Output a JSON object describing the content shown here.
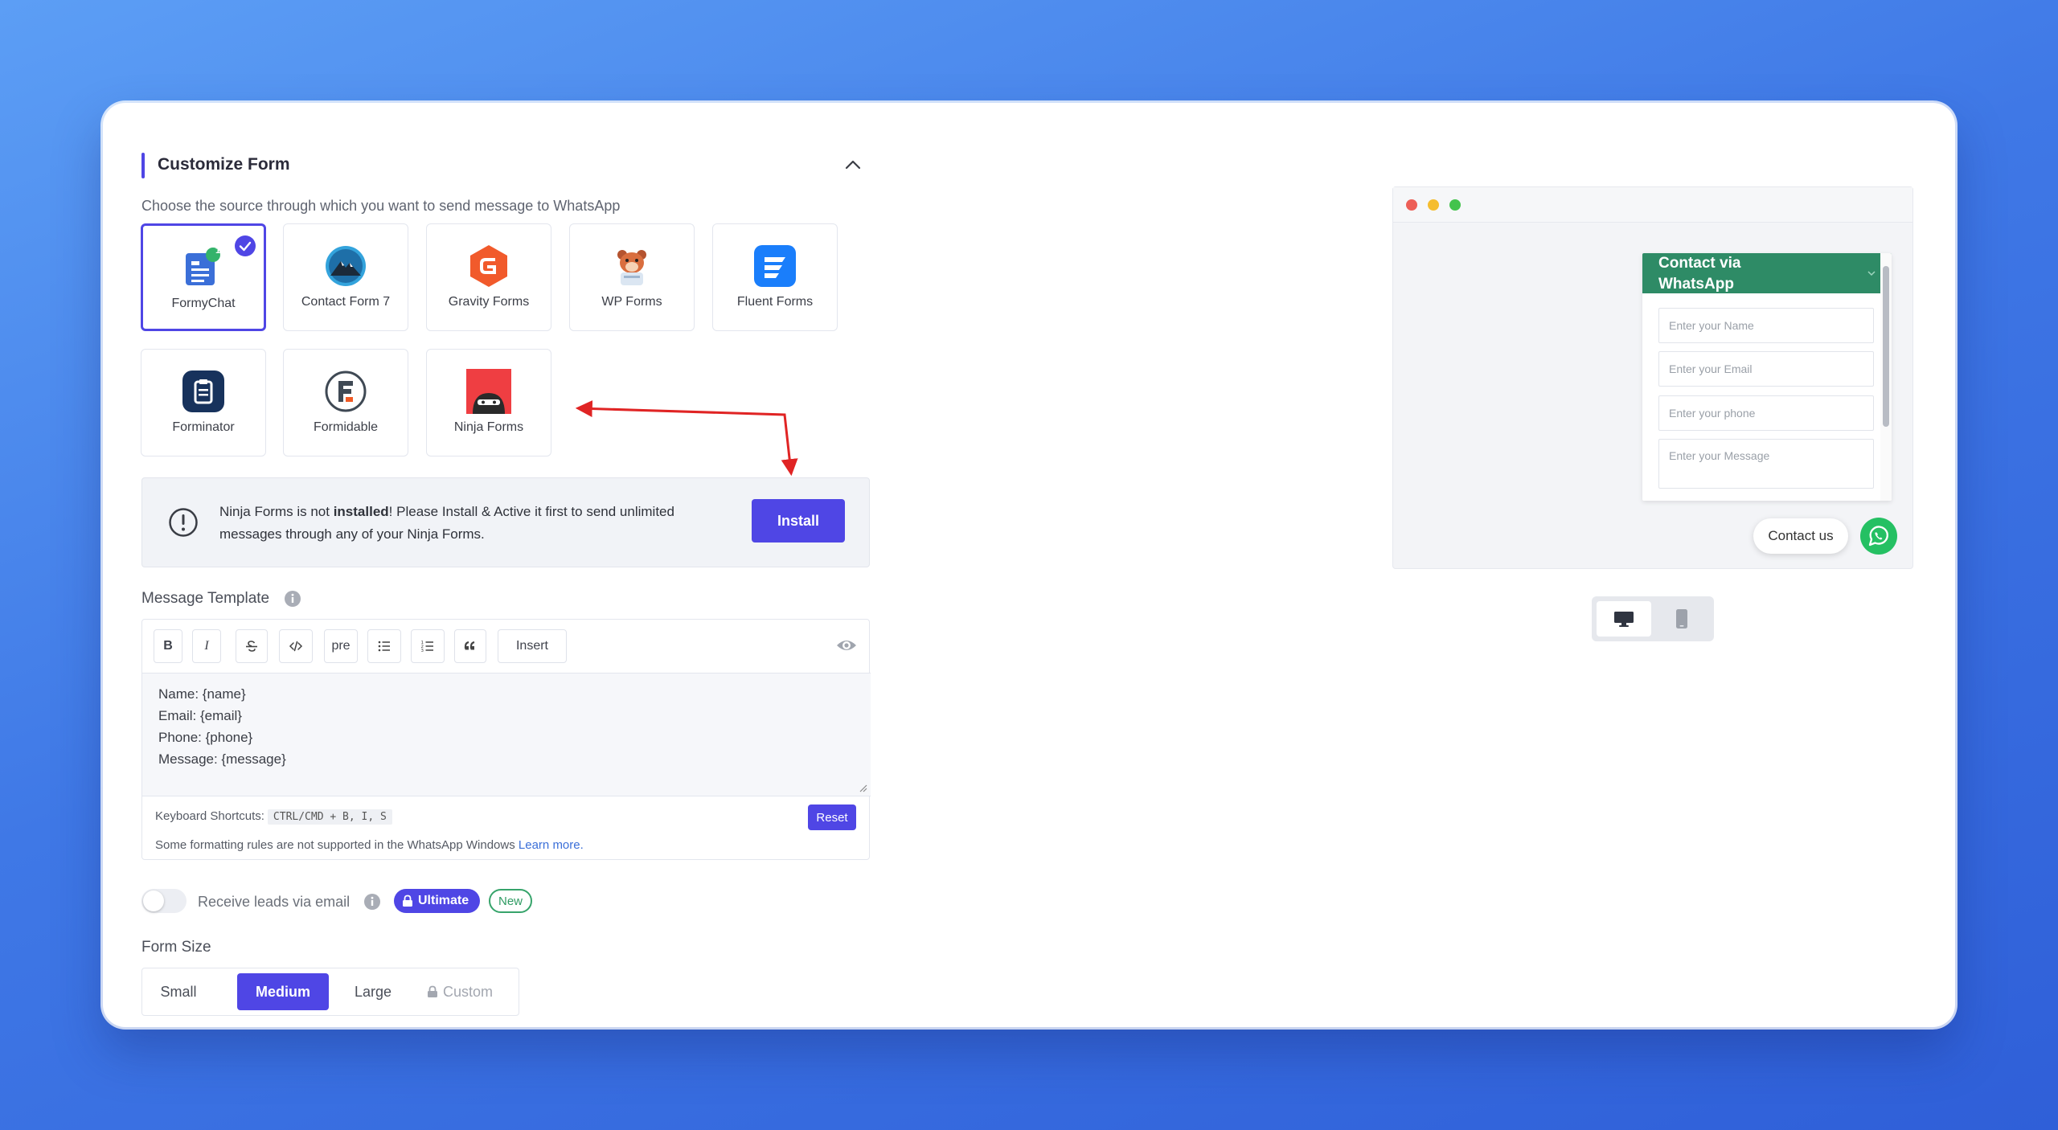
{
  "section": {
    "title": "Customize Form",
    "subtitle": "Choose the source through which you want to send message to WhatsApp"
  },
  "sources": [
    {
      "label": "FormyChat",
      "icon": "formychat-icon",
      "selected": true
    },
    {
      "label": "Contact Form 7",
      "icon": "contact-form-7-icon",
      "selected": false
    },
    {
      "label": "Gravity Forms",
      "icon": "gravity-forms-icon",
      "selected": false
    },
    {
      "label": "WP Forms",
      "icon": "wp-forms-icon",
      "selected": false
    },
    {
      "label": "Fluent Forms",
      "icon": "fluent-forms-icon",
      "selected": false
    },
    {
      "label": "Forminator",
      "icon": "forminator-icon",
      "selected": false
    },
    {
      "label": "Formidable",
      "icon": "formidable-icon",
      "selected": false
    },
    {
      "label": "Ninja Forms",
      "icon": "ninja-forms-icon",
      "selected": false
    }
  ],
  "formychat_badge": "1",
  "alert": {
    "pre": "Ninja Forms is not ",
    "bold": "installed",
    "post": "! Please Install & Active it first to send unlimited messages through any of your Ninja Forms.",
    "button": "Install"
  },
  "message_template": {
    "label": "Message Template",
    "toolbar": {
      "bold": "B",
      "italic": "I",
      "pre": "pre",
      "insert": "Insert"
    },
    "lines": [
      "Name: {name}",
      "Email: {email}",
      "Phone: {phone}",
      "Message: {message}"
    ],
    "shortcuts_label": "Keyboard Shortcuts:",
    "shortcuts_keys": "CTRL/CMD + B, I, S",
    "reset": "Reset",
    "note": "Some formatting rules are not supported in the WhatsApp Windows",
    "learn_more": "Learn more."
  },
  "leads": {
    "label": "Receive leads via email",
    "ultimate": "Ultimate",
    "new": "New",
    "enabled": false
  },
  "form_size": {
    "label": "Form Size",
    "options": [
      "Small",
      "Medium",
      "Large",
      "Custom"
    ],
    "selected": "Medium"
  },
  "preview": {
    "widget_title": "Contact via WhatsApp",
    "name_placeholder": "Enter your Name",
    "email_placeholder": "Enter your Email",
    "phone_placeholder": "Enter your phone",
    "message_placeholder": "Enter your Message",
    "contact_label": "Contact us"
  },
  "colors": {
    "accent": "#4f46e5",
    "whatsapp_green": "#2e8b66",
    "alert_arrow": "#e02424"
  }
}
